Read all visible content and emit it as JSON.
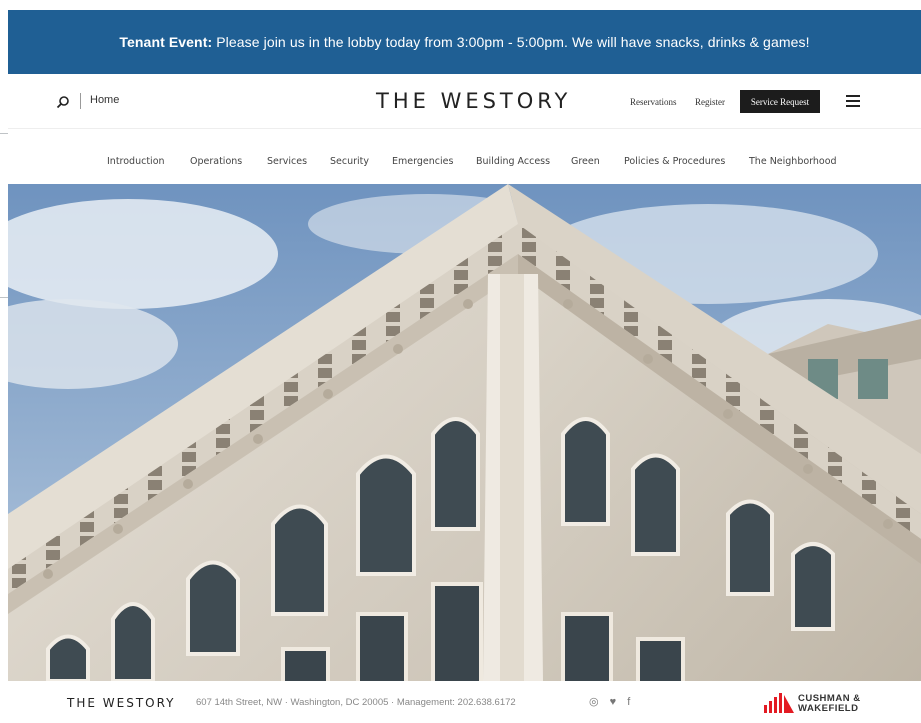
{
  "banner": {
    "label": "Tenant Event:",
    "message": "Please join us in the lobby today from 3:00pm - 5:00pm. We will have snacks, drinks & games!"
  },
  "header": {
    "home": "Home",
    "logo": "THE WESTORY",
    "reservations": "Reservations",
    "register": "Register",
    "service_request": "Service Request"
  },
  "nav": {
    "items": [
      "Introduction",
      "Operations",
      "Services",
      "Security",
      "Emergencies",
      "Building Access",
      "Green",
      "Policies & Procedures",
      "The Neighborhood"
    ]
  },
  "footer": {
    "logo": "THE WESTORY",
    "address": "607 14th Street, NW · Washington, DC 20005 · Management: 202.638.6172",
    "icons": [
      "instagram-icon",
      "twitter-icon",
      "facebook-icon"
    ],
    "cw_line1": "CUSHMAN &",
    "cw_line2": "WAKEFIELD"
  },
  "colors": {
    "banner": "#1f5f94",
    "service_button": "#1c1c1c",
    "cw_red": "#e31b23"
  }
}
